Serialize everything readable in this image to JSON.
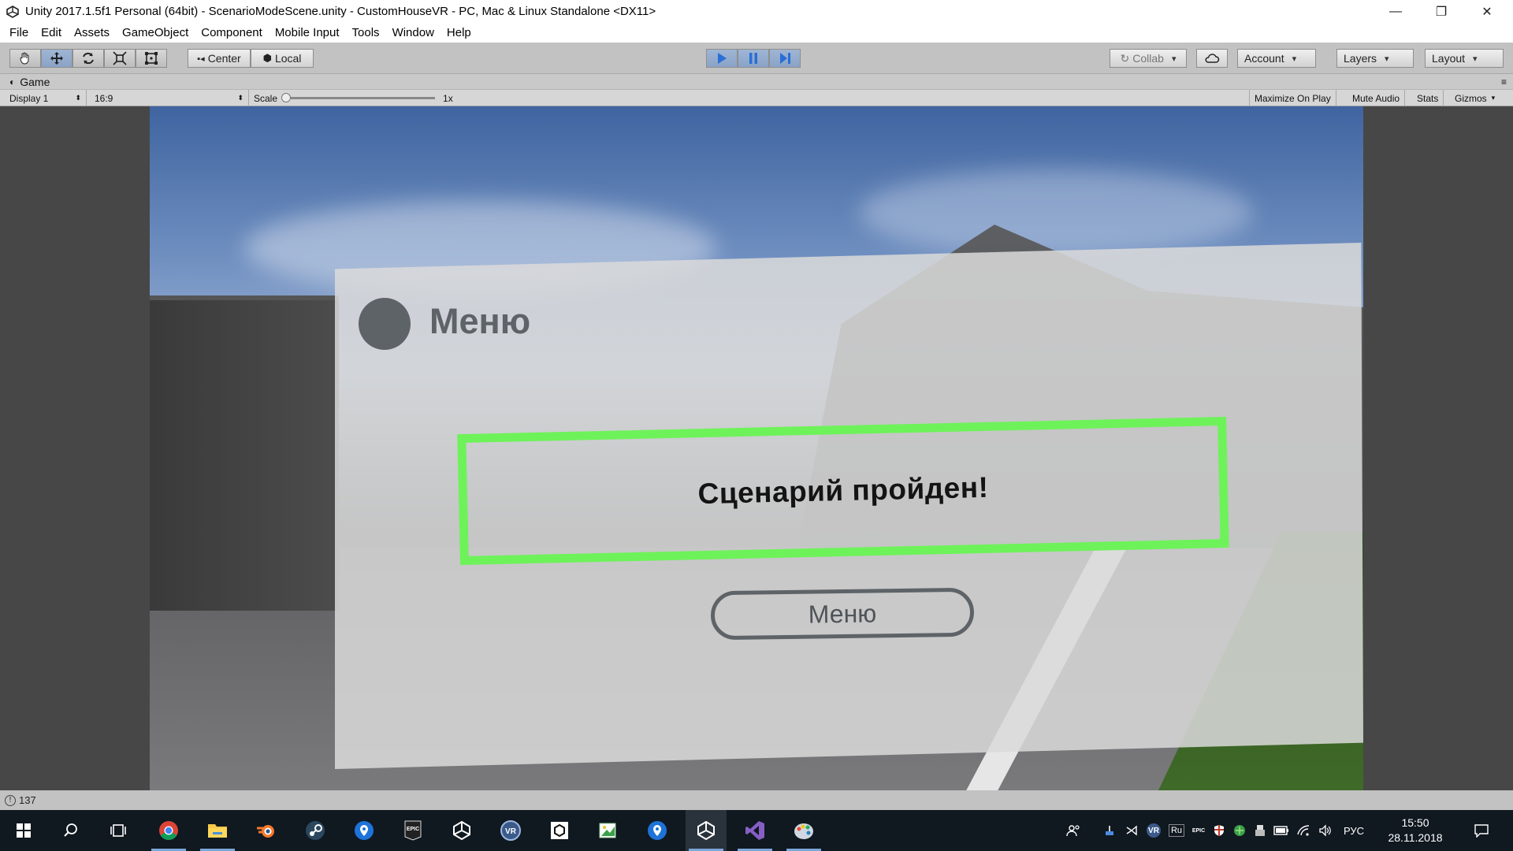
{
  "window": {
    "title": "Unity 2017.1.5f1 Personal (64bit) - ScenarioModeScene.unity - CustomHouseVR - PC, Mac & Linux Standalone <DX11>",
    "minimize": "—",
    "restore": "❐",
    "close": "✕"
  },
  "menu": [
    "File",
    "Edit",
    "Assets",
    "GameObject",
    "Component",
    "Mobile Input",
    "Tools",
    "Window",
    "Help"
  ],
  "toolbar": {
    "center_label": "Center",
    "local_label": "Local",
    "collab_label": "Collab",
    "account_label": "Account",
    "layers_label": "Layers",
    "layout_label": "Layout",
    "play_state": "playing"
  },
  "game_tab": {
    "title": "Game",
    "display": "Display 1",
    "aspect": "16:9",
    "scale_label": "Scale",
    "scale_value": "1x",
    "maximize_on_play": "Maximize On Play",
    "mute_audio": "Mute Audio",
    "stats": "Stats",
    "gizmos": "Gizmos"
  },
  "vr_panel": {
    "title": "Меню",
    "message": "Сценарий пройден!",
    "menu_button": "Меню",
    "highlight_color": "#6ef25a"
  },
  "status": {
    "count": "137"
  },
  "taskbar": {
    "apps": [
      "chrome-icon",
      "file-explorer-icon",
      "blender-icon",
      "steam-icon",
      "maps-icon",
      "epic-games-icon",
      "unity-icon",
      "vr-icon",
      "unity-hub-icon",
      "paint-icon",
      "maps-icon-2",
      "unity-editor-icon",
      "visual-studio-icon",
      "paint-3d-icon"
    ],
    "lang1": "Ru",
    "lang2": "РУС",
    "time": "15:50",
    "date": "28.11.2018",
    "epic_text": "EPIC",
    "vr_text": "VR"
  }
}
